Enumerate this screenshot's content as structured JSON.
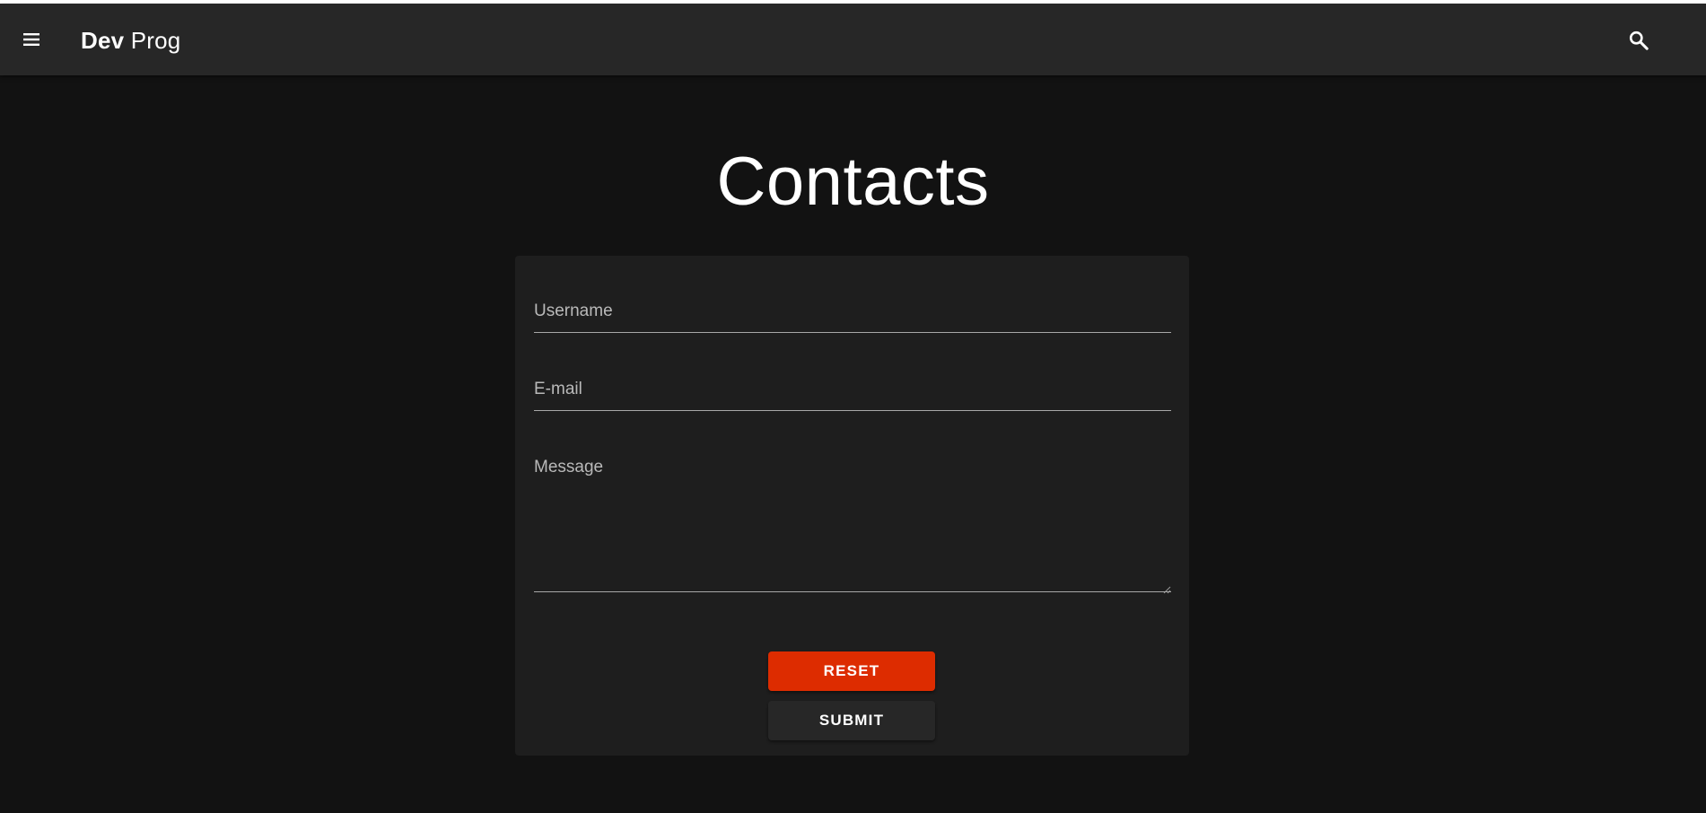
{
  "app": {
    "brand_bold": "Dev",
    "brand_regular": "Prog",
    "menu_icon": "hamburger-menu-icon",
    "search_icon": "search-icon"
  },
  "page": {
    "title": "Contacts"
  },
  "form": {
    "username": {
      "label": "Username",
      "value": ""
    },
    "email": {
      "label": "E-mail",
      "value": ""
    },
    "message": {
      "label": "Message",
      "value": ""
    },
    "reset_label": "RESET",
    "submit_label": "SUBMIT"
  },
  "colors": {
    "background": "#121212",
    "appbar": "#272727",
    "card": "#1e1e1e",
    "reset_button": "#dd2c00",
    "submit_button": "#272727"
  }
}
